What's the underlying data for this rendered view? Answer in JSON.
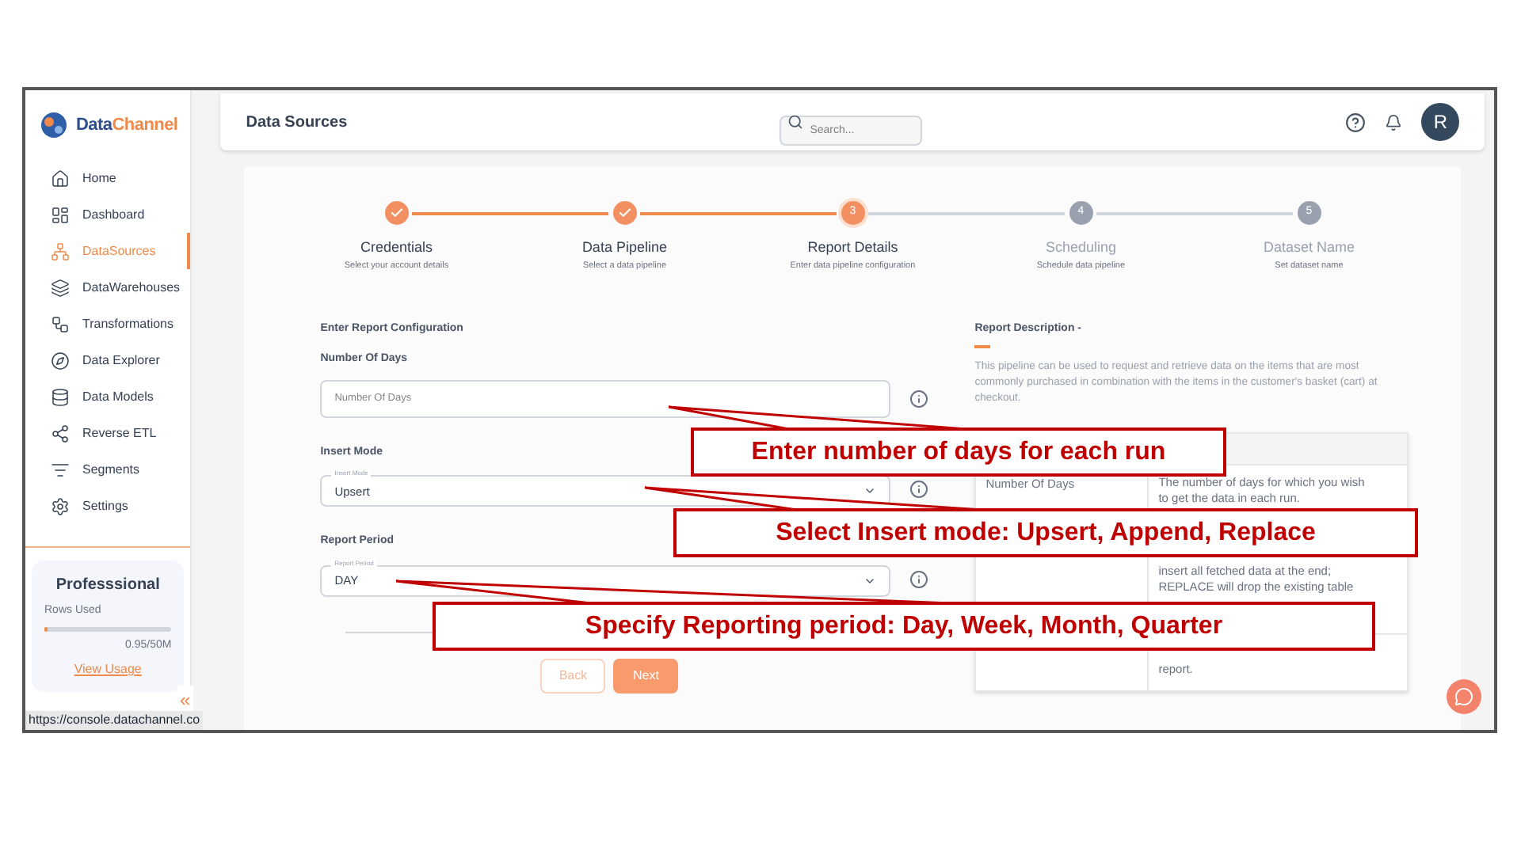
{
  "sidebar": {
    "brand": {
      "first": "Data",
      "second": "Channel"
    },
    "items": [
      {
        "label": "Home",
        "selected": false
      },
      {
        "label": "Dashboard",
        "selected": false
      },
      {
        "label": "DataSources",
        "selected": true
      },
      {
        "label": "DataWarehouses",
        "selected": false
      },
      {
        "label": "Transformations",
        "selected": false
      },
      {
        "label": "Data Explorer",
        "selected": false
      },
      {
        "label": "Data Models",
        "selected": false
      },
      {
        "label": "Reverse ETL",
        "selected": false
      },
      {
        "label": "Segments",
        "selected": false
      },
      {
        "label": "Settings",
        "selected": false
      }
    ],
    "plan": {
      "name": "Professsional",
      "rows_label": "Rows Used",
      "level": 0.02,
      "usage": "0.95/50M",
      "link": "View Usage"
    },
    "collapse": "«"
  },
  "status_url": "https://console.datachannel.co",
  "header": {
    "title": "Data Sources",
    "search_placeholder": "Search...",
    "avatar": "R"
  },
  "steps": [
    {
      "title": "Credentials",
      "subtitle": "Select your account details",
      "completed": true,
      "selected": false
    },
    {
      "title": "Data Pipeline",
      "subtitle": "Select a data pipeline",
      "completed": true,
      "selected": false
    },
    {
      "title": "Report Details",
      "subtitle": "Enter data pipeline configuration",
      "completed": false,
      "selected": true,
      "number": "3"
    },
    {
      "title": "Scheduling",
      "subtitle": "Schedule data pipeline",
      "completed": false,
      "selected": false,
      "number": "4"
    },
    {
      "title": "Dataset Name",
      "subtitle": "Set dataset name",
      "completed": false,
      "selected": false,
      "number": "5"
    }
  ],
  "form": {
    "heading": "Enter Report Configuration",
    "fields": [
      {
        "kind": "text",
        "label": "Number Of Days",
        "placeholder": "Number Of Days"
      },
      {
        "kind": "select",
        "label": "Insert Mode",
        "floating_label": "Insert Mode",
        "value": "Upsert"
      },
      {
        "kind": "select",
        "label": "Report Period",
        "floating_label": "Report Period",
        "value": "DAY"
      }
    ],
    "buttons": [
      {
        "label": "Back",
        "kind": "secondary"
      },
      {
        "label": "Next",
        "kind": "primary"
      }
    ]
  },
  "description": {
    "heading": "Report Description -",
    "text": "This pipeline can be used to request and retrieve data on the items that are most commonly purchased in combination with the items in the customer's basket (cart) at checkout.",
    "rows": [
      {
        "name": "Number Of Days",
        "text": "The number of days for which you wish to get the data in each run."
      },
      {
        "text": "insert all fetched data at the end; REPLACE will drop the existing table"
      },
      {
        "text": "report."
      }
    ]
  },
  "callouts": [
    {
      "text": "Enter number of days for each run"
    },
    {
      "text": "Select Insert mode: Upsert, Append, Replace"
    },
    {
      "text": "Specify Reporting period: Day, Week, Month, Quarter"
    }
  ]
}
